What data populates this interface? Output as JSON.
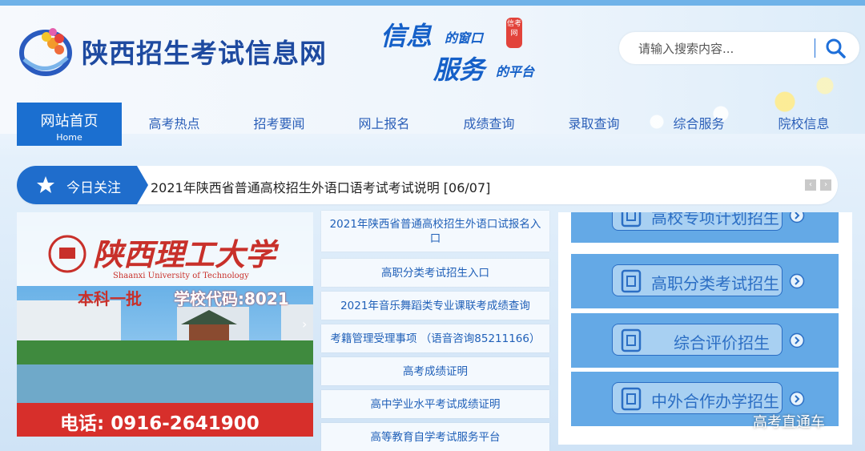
{
  "header": {
    "site_title": "陕西招生考试信息网",
    "slogan": {
      "line1_big": "信息",
      "line1_small": "的窗口",
      "line2_big": "服务",
      "line2_small": "的平台",
      "stamp": "信考网"
    },
    "search": {
      "placeholder": "请输入搜索内容..."
    }
  },
  "nav": {
    "items": [
      {
        "label": "网站首页",
        "sub": "Home"
      },
      {
        "label": "高考热点"
      },
      {
        "label": "招考要闻"
      },
      {
        "label": "网上报名"
      },
      {
        "label": "成绩查询"
      },
      {
        "label": "录取查询"
      },
      {
        "label": "综合服务"
      },
      {
        "label": "院校信息"
      }
    ]
  },
  "notice": {
    "label": "今日关注",
    "text": "2021年陕西省普通高校招生外语口语考试考试说明  [06/07]"
  },
  "banner": {
    "university": "陕西理工大学",
    "university_en": "Shaanxi University of Technology",
    "batch": "本科一批",
    "code": "学校代码:8021",
    "phone": "电话: 0916-2641900"
  },
  "links": [
    "2021年陕西省普通高校招生外语口试报名入口",
    "高职分类考试招生入口",
    "2021年音乐舞蹈类专业课联考成绩查询",
    "考籍管理受理事项 （语音咨询85211166）",
    "高考成绩证明",
    "高中学业水平考试成绩证明",
    "高等教育自学考试服务平台"
  ],
  "categories": [
    "高校专项计划招生",
    "高职分类考试招生",
    "综合评价招生",
    "中外合作办学招生"
  ],
  "watermark": "高考直通车",
  "colors": {
    "primary": "#1b6fd0",
    "nav_text": "#2b5fb8",
    "panel_blue": "#64a9e6",
    "phone_bar": "#d72f2b"
  }
}
